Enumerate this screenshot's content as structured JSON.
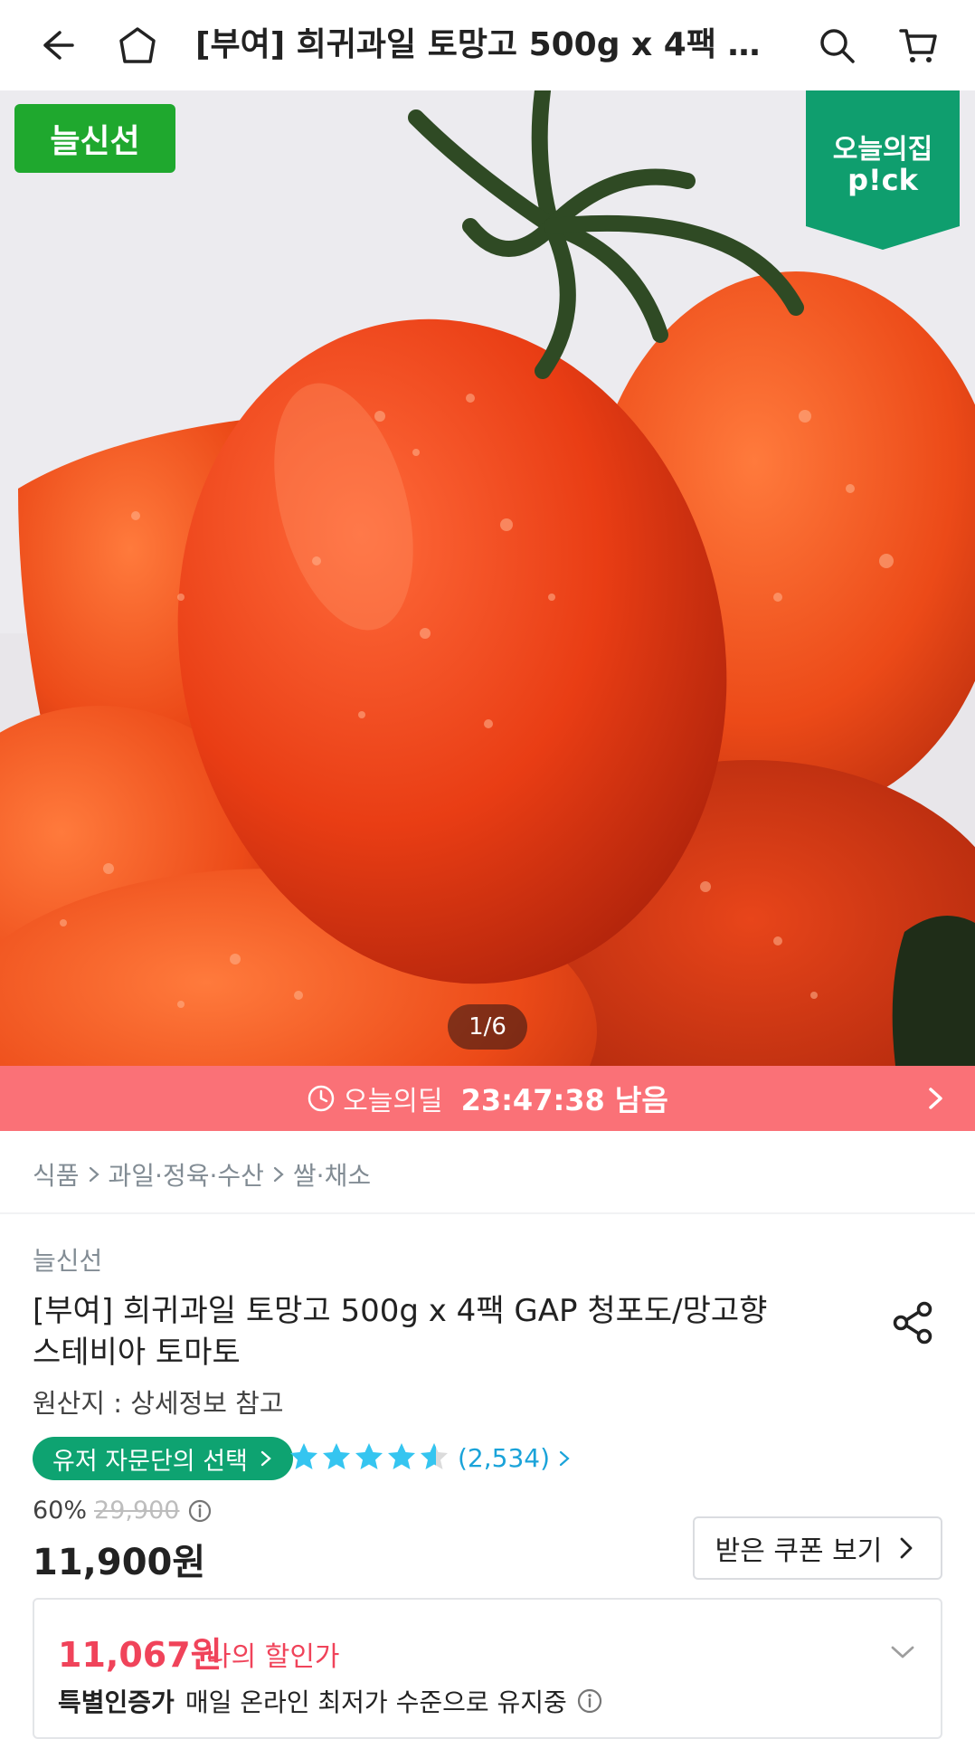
{
  "header": {
    "title": "[부여] 희귀과일 토망고 500g x 4팩 GA…"
  },
  "hero": {
    "badge_fresh": "늘신선",
    "badge_pick_line1": "오늘의집",
    "badge_pick_line2": "p!ck",
    "pager": "1/6"
  },
  "deal": {
    "label": "오늘의딜",
    "time_left": "23:47:38 남음"
  },
  "breadcrumb": {
    "items": [
      "식품",
      "과일·정육·수산",
      "쌀·채소"
    ]
  },
  "product": {
    "brand": "늘신선",
    "name_line1": "[부여] 희귀과일 토망고 500g x 4팩 GAP 청포도/망고향",
    "name_line2": "스테비아 토마토",
    "origin": "원산지 : 상세정보 참고",
    "panel_badge": "유저 자문단의 선택",
    "rating": 4.5,
    "review_count": "(2,534)",
    "discount_percent": "60%",
    "original_price": "29,900",
    "price": "11,900원",
    "coupon_button": "받은 쿠폰 보기"
  },
  "my_discount": {
    "price": "11,067원",
    "label": "나의 할인가",
    "note_bold": "특별인증가",
    "note_text": "매일 온라인 최저가 수준으로 유지중"
  },
  "colors": {
    "deal_bar": "#fa7177",
    "fresh_badge": "#1fa82e",
    "pick_badge": "#0f9e6e",
    "panel_badge": "#0ea371",
    "star": "#35c5f0",
    "discount_red": "#f0435a"
  }
}
